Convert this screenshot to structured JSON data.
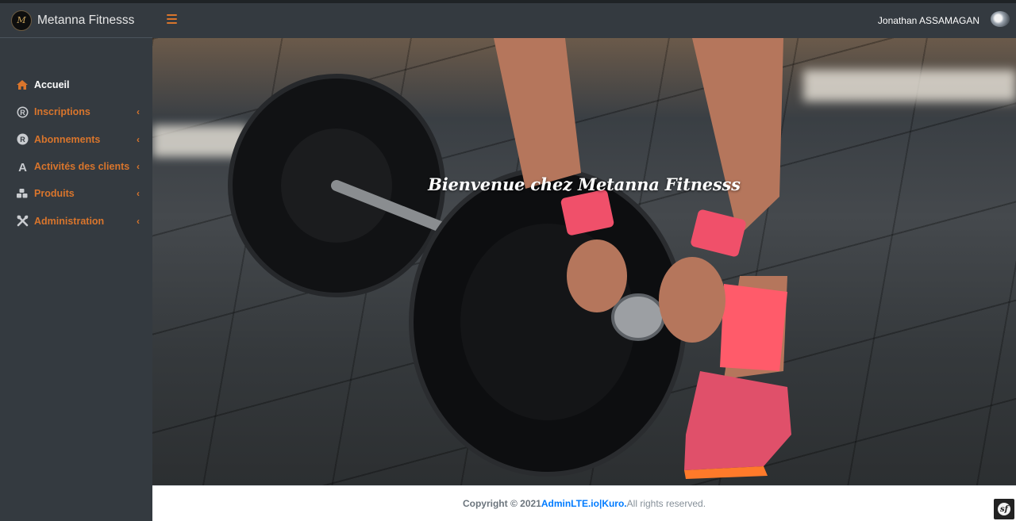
{
  "brand": {
    "name": "Metanna Fitnesss",
    "logo_text": "M",
    "logo_icon": "metanna-logo"
  },
  "navbar": {
    "menu_icon": "hamburger-icon",
    "user_name": "Jonathan ASSAMAGAN",
    "avatar_icon": "user-avatar"
  },
  "sidebar": {
    "items": [
      {
        "label": "Accueil",
        "icon": "home-icon",
        "active": true,
        "has_submenu": false
      },
      {
        "label": "Inscriptions",
        "icon": "registered-icon",
        "active": false,
        "has_submenu": true
      },
      {
        "label": "Abonnements",
        "icon": "registered-icon",
        "active": false,
        "has_submenu": true
      },
      {
        "label": "Activités des clients",
        "icon": "letter-a-icon",
        "active": false,
        "has_submenu": true
      },
      {
        "label": "Produits",
        "icon": "cubes-icon",
        "active": false,
        "has_submenu": true
      },
      {
        "label": "Administration",
        "icon": "tools-icon",
        "active": false,
        "has_submenu": true
      }
    ],
    "chevron": "‹"
  },
  "hero": {
    "title": "Bienvenue chez Metanna Fitnesss"
  },
  "footer": {
    "copyright": "Copyright © 2021 ",
    "link1": "AdminLTE.io",
    "separator": " | ",
    "link2": "Kuro.",
    "rights": "All rights reserved.",
    "badge_icon": "symfony-icon"
  },
  "colors": {
    "accent": "#d9752c",
    "sidebar_bg": "#343a40",
    "link": "#007bff"
  }
}
